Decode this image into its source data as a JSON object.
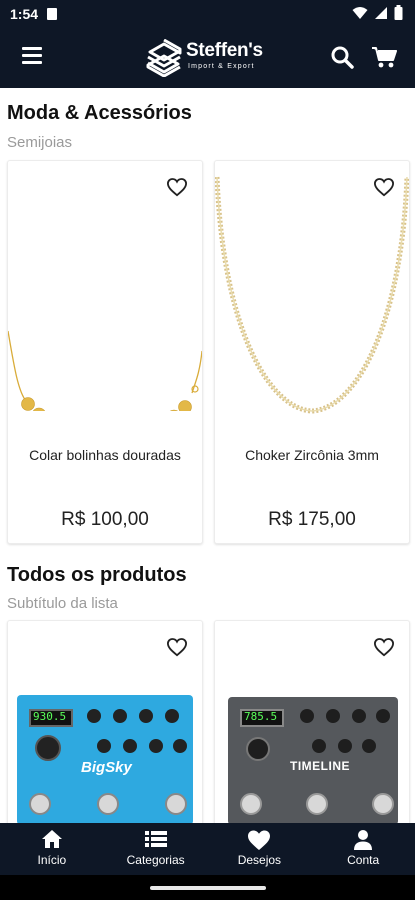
{
  "status_bar": {
    "time": "1:54"
  },
  "header": {
    "brand_name": "Steffen's",
    "brand_tagline": "Import & Export"
  },
  "sections": [
    {
      "title": "Moda & Acessórios",
      "subtitle": "Semijoias",
      "products": [
        {
          "name": "Colar bolinhas douradas",
          "price": "R$  100,00"
        },
        {
          "name": "Choker Zircônia 3mm",
          "price": "R$  175,00"
        }
      ]
    },
    {
      "title": "Todos os produtos",
      "subtitle": "Subtítulo da lista",
      "products": [
        {
          "pedal_display": "930.5",
          "pedal_brand": "BigSky"
        },
        {
          "pedal_display": "785.5",
          "pedal_brand": "TIMELINE"
        }
      ]
    }
  ],
  "bottom_nav": [
    {
      "label": "Início",
      "icon": "home-icon"
    },
    {
      "label": "Categorias",
      "icon": "list-icon"
    },
    {
      "label": "Desejos",
      "icon": "heart-icon"
    },
    {
      "label": "Conta",
      "icon": "person-icon"
    }
  ],
  "colors": {
    "primary": "#0e1726",
    "gold": "#e0b53a",
    "pedal_blue": "#2ea9e0",
    "pedal_gray": "#55585c"
  }
}
